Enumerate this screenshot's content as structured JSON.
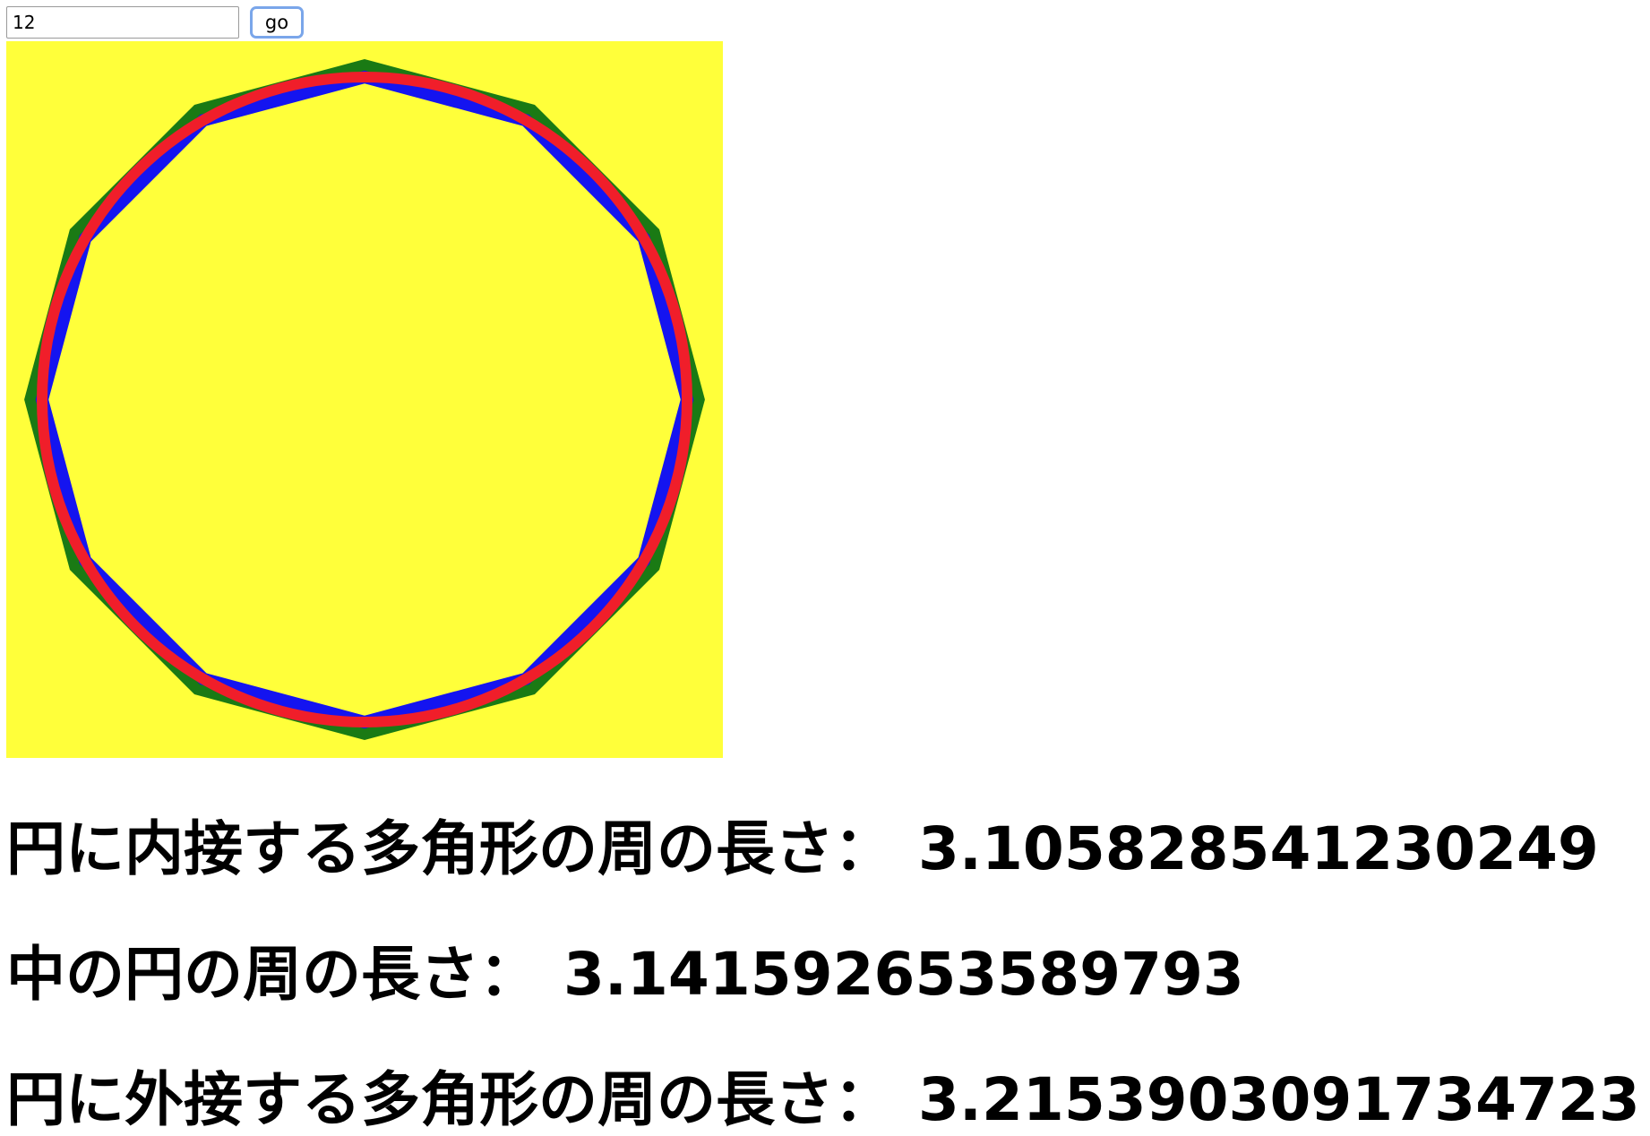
{
  "controls": {
    "sides_value": "12",
    "go_label": "go"
  },
  "drawing": {
    "sides": 12,
    "colors": {
      "background": "#ffff3a",
      "circumscribed": "#1a7a14",
      "inscribed": "#1414f0",
      "circle": "#f01e2a"
    }
  },
  "results": {
    "inner_label": "円に内接する多角形の周の長さ：",
    "inner_value": "3.105828541230249",
    "circle_label": "中の円の周の長さ：",
    "circle_value": "3.141592653589793",
    "outer_label": "円に外接する多角形の周の長さ：",
    "outer_value": "3.2153903091734723"
  }
}
